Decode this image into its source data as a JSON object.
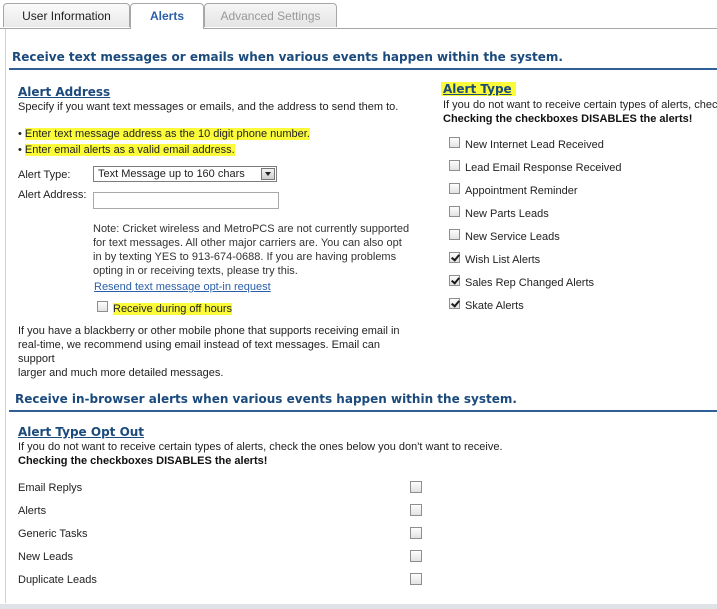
{
  "tabs": {
    "user_information": "User Information",
    "alerts": "Alerts",
    "advanced_settings": "Advanced Settings"
  },
  "section1": {
    "title": "Receive text messages or emails when various events happen within the system."
  },
  "alert_address": {
    "heading": "Alert Address",
    "description": "Specify if you want text messages or emails, and the address to send them to.",
    "bullet1": "Enter text message address as the 10 digit phone number.",
    "bullet2": "Enter email alerts as a valid email address.",
    "bullet_mark": "•",
    "alert_type_label": "Alert Type:",
    "alert_type_value": "Text Message up to 160 chars",
    "alert_address_label": "Alert Address:",
    "alert_address_value": "",
    "note_line1": "Note: Cricket wireless and MetroPCS are not currently supported",
    "note_line2": "for text messages. All other major carriers are. You can also opt",
    "note_line3": "in by texting YES to 913-674-0688. If you are having problems",
    "note_line4": "opting in or receiving texts, please try this.",
    "resend_link": "Resend text message opt-in request",
    "off_hours_label": "Receive during off hours",
    "off_hours_checked": false,
    "bb_line1": "If you have a blackberry or other mobile phone that supports receiving email in",
    "bb_line2": "real-time, we recommend using email instead of text messages. Email can support",
    "bb_line3": "larger and much more detailed messages."
  },
  "alert_type": {
    "heading": "Alert Type",
    "description": "If you do not want to receive certain types of alerts, check the ones below you don't want to receive.",
    "warning": "Checking the checkboxes DISABLES the alerts!",
    "items": [
      {
        "label": "New Internet Lead Received",
        "checked": false
      },
      {
        "label": "Lead Email Response Received",
        "checked": false
      },
      {
        "label": "Appointment Reminder",
        "checked": false
      },
      {
        "label": "New Parts Leads",
        "checked": false
      },
      {
        "label": "New Service Leads",
        "checked": false
      },
      {
        "label": "Wish List Alerts",
        "checked": true
      },
      {
        "label": "Sales Rep Changed Alerts",
        "checked": true
      },
      {
        "label": "Skate Alerts",
        "checked": true
      }
    ]
  },
  "section2": {
    "title": "Receive in-browser alerts when various events happen within the system."
  },
  "opt_out": {
    "heading": "Alert Type Opt Out",
    "description": "If you do not want to receive certain types of alerts, check the ones below you don't want to receive.",
    "warning": "Checking the checkboxes DISABLES the alerts!",
    "items": [
      {
        "label": "Email Replys",
        "checked": false
      },
      {
        "label": "Alerts",
        "checked": false
      },
      {
        "label": "Generic Tasks",
        "checked": false
      },
      {
        "label": "New Leads",
        "checked": false
      },
      {
        "label": "Duplicate Leads",
        "checked": false
      }
    ]
  },
  "colors": {
    "heading_blue": "#1b4a7d",
    "rule_blue": "#2f5f95",
    "highlight": "#fbfb3a",
    "link_blue": "#2a5fa8"
  }
}
